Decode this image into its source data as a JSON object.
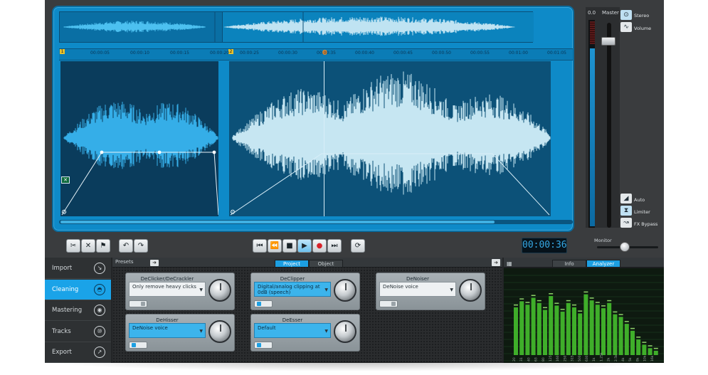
{
  "overview": {
    "label": "overview waveform"
  },
  "ruler": {
    "markers": [
      "1",
      "2"
    ],
    "ticks1": [
      "00:00:05",
      "00:00:10",
      "00:00:15",
      "00:00:20"
    ],
    "ticks2": [
      "00:00:25",
      "00:00:30",
      "00:00:35",
      "00:00:40",
      "00:00:45",
      "00:00:50",
      "00:00:55",
      "00:01:00",
      "00:01:05"
    ]
  },
  "meters": {
    "peak": "0.0",
    "master": "Master"
  },
  "side": {
    "stereo": "Stereo",
    "volume": "Volume",
    "auto": "Auto",
    "limiter": "Limiter",
    "fx_bypass": "FX Bypass"
  },
  "transport": {
    "time": "00:00:36"
  },
  "monitor": {
    "label": "Monitor",
    "level": 0.45
  },
  "nav": {
    "items": [
      {
        "label": "Import",
        "icon": "import-icon"
      },
      {
        "label": "Cleaning",
        "icon": "cleaning-icon"
      },
      {
        "label": "Mastering",
        "icon": "mastering-icon"
      },
      {
        "label": "Tracks",
        "icon": "tracks-icon"
      },
      {
        "label": "Export",
        "icon": "export-icon"
      }
    ],
    "active": 1
  },
  "fx": {
    "presets_label": "Presets",
    "tabs": [
      "Project",
      "Object"
    ],
    "modules": [
      {
        "title": "DeClicker/DeCrackler",
        "value": "Only remove heavy clicks",
        "active": false
      },
      {
        "title": "DeClipper",
        "value": "Digital/analog clipping at 0dB (speech)",
        "active": true
      },
      {
        "title": "DeNoiser",
        "value": "DeNoise voice",
        "active": false
      },
      {
        "title": "DeHisser",
        "value": "DeNoise voice",
        "active": true
      },
      {
        "title": "DeEsser",
        "value": "Default",
        "active": true
      }
    ]
  },
  "analyzer": {
    "tabs": [
      "Info",
      "Analyzer"
    ],
    "levels": [
      0.55,
      0.62,
      0.58,
      0.66,
      0.6,
      0.52,
      0.68,
      0.57,
      0.5,
      0.6,
      0.55,
      0.48,
      0.7,
      0.63,
      0.58,
      0.54,
      0.6,
      0.47,
      0.44,
      0.36,
      0.28,
      0.18,
      0.12,
      0.08,
      0.05
    ],
    "freq_labels": [
      "20",
      "31",
      "40",
      "63",
      "80",
      "125",
      "160",
      "250",
      "315",
      "500",
      "630",
      "1k",
      "1.25k",
      "2k",
      "2.5k",
      "4k",
      "5k",
      "8k",
      "10k",
      "16k"
    ]
  },
  "colors": {
    "accent": "#1aa3e8",
    "editor": "#0e8ac8",
    "meter_green": "#3fae2a"
  }
}
